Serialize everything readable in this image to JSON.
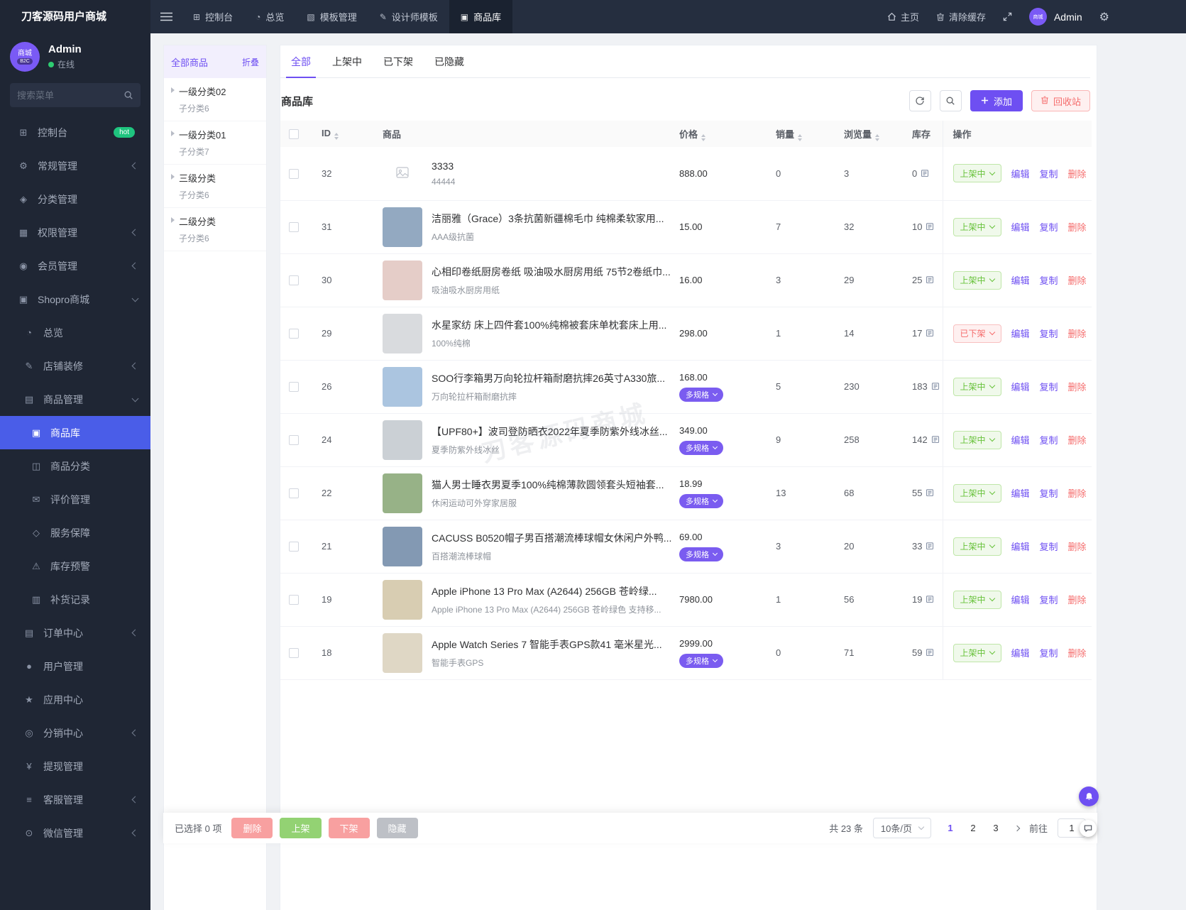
{
  "app": {
    "brand": "刀客源码用户商城",
    "watermark": "刀客源码商城"
  },
  "colors": {
    "accent_purple": "#6e4ff2",
    "sidebar_active_blue": "#4a5de8",
    "success_green": "#67c23a",
    "danger_red": "#f56c6c",
    "hot_badge_green": "#1fc47f",
    "sidebar_bg": "#1f2634",
    "navbar_bg": "#252e3f"
  },
  "navbar": {
    "tabs": [
      {
        "label": "控制台",
        "glyph": "⊞",
        "icon_name": "console-icon"
      },
      {
        "label": "总览",
        "glyph": "◔",
        "icon_name": "overview-icon"
      },
      {
        "label": "模板管理",
        "glyph": "▧",
        "icon_name": "template-icon"
      },
      {
        "label": "设计师模板",
        "glyph": "✎",
        "icon_name": "designer-template-icon"
      },
      {
        "label": "商品库",
        "glyph": "▣",
        "icon_name": "product-library-icon",
        "active": true
      }
    ],
    "home_label": "主页",
    "clear_cache_label": "清除缓存",
    "avatar_text": "商城",
    "user_name": "Admin"
  },
  "sidebar": {
    "profile": {
      "avatar_text": "商城",
      "avatar_badge": "B2C",
      "name": "Admin",
      "status": "在线"
    },
    "search_placeholder": "搜索菜单",
    "items": [
      {
        "label": "控制台",
        "glyph": "⊞",
        "icon_name": "console-icon",
        "cls": "lvl1",
        "badge": "hot"
      },
      {
        "label": "常规管理",
        "glyph": "⚙",
        "icon_name": "settings-icon",
        "cls": "lvl1",
        "chevron": true
      },
      {
        "label": "分类管理",
        "glyph": "◈",
        "icon_name": "category-icon",
        "cls": "lvl1"
      },
      {
        "label": "权限管理",
        "glyph": "▦",
        "icon_name": "permissions-icon",
        "cls": "lvl1",
        "chevron": true
      },
      {
        "label": "会员管理",
        "glyph": "◉",
        "icon_name": "members-icon",
        "cls": "lvl1",
        "chevron": true
      },
      {
        "label": "Shopro商城",
        "glyph": "▣",
        "icon_name": "shop-cart-icon",
        "cls": "lvl1",
        "chevron": true,
        "expanded": true
      },
      {
        "label": "总览",
        "glyph": "◔",
        "icon_name": "overview-icon",
        "cls": "lvl2"
      },
      {
        "label": "店铺装修",
        "glyph": "✎",
        "icon_name": "shop-decor-icon",
        "cls": "lvl2",
        "chevron": true
      },
      {
        "label": "商品管理",
        "glyph": "▤",
        "icon_name": "goods-icon",
        "cls": "lvl2",
        "chevron": true,
        "expanded": true
      },
      {
        "label": "商品库",
        "glyph": "▣",
        "icon_name": "product-library-icon",
        "cls": "lvl3",
        "active": true
      },
      {
        "label": "商品分类",
        "glyph": "◫",
        "icon_name": "product-category-icon",
        "cls": "lvl3"
      },
      {
        "label": "评价管理",
        "glyph": "✉",
        "icon_name": "review-icon",
        "cls": "lvl3"
      },
      {
        "label": "服务保障",
        "glyph": "◇",
        "icon_name": "service-guarantee-icon",
        "cls": "lvl3"
      },
      {
        "label": "库存预警",
        "glyph": "⚠",
        "icon_name": "stock-warning-icon",
        "cls": "lvl3"
      },
      {
        "label": "补货记录",
        "glyph": "▥",
        "icon_name": "restock-record-icon",
        "cls": "lvl3"
      },
      {
        "label": "订单中心",
        "glyph": "▤",
        "icon_name": "order-center-icon",
        "cls": "lvl2",
        "chevron": true
      },
      {
        "label": "用户管理",
        "glyph": "●",
        "icon_name": "user-management-icon",
        "cls": "lvl2"
      },
      {
        "label": "应用中心",
        "glyph": "★",
        "icon_name": "app-center-icon",
        "cls": "lvl2"
      },
      {
        "label": "分销中心",
        "glyph": "◎",
        "icon_name": "distribution-icon",
        "cls": "lvl2",
        "chevron": true
      },
      {
        "label": "提现管理",
        "glyph": "¥",
        "icon_name": "withdraw-icon",
        "cls": "lvl2"
      },
      {
        "label": "客服管理",
        "glyph": "≡",
        "icon_name": "support-icon",
        "cls": "lvl2",
        "chevron": true
      },
      {
        "label": "微信管理",
        "glyph": "⊙",
        "icon_name": "wechat-icon",
        "cls": "lvl2",
        "chevron": true
      }
    ]
  },
  "category_panel": {
    "title": "全部商品",
    "collapse_label": "折叠",
    "items": [
      {
        "label": "一级分类02",
        "sub": "子分类6"
      },
      {
        "label": "一级分类01",
        "sub": "子分类7"
      },
      {
        "label": "三级分类",
        "sub": "子分类6"
      },
      {
        "label": "二级分类",
        "sub": "子分类6"
      }
    ]
  },
  "main": {
    "tabs": [
      {
        "label": "全部",
        "active": true
      },
      {
        "label": "上架中"
      },
      {
        "label": "已下架"
      },
      {
        "label": "已隐藏"
      }
    ],
    "panel_title": "商品库",
    "add_label": "添加",
    "recycle_label": "回收站",
    "multi_spec_label": "多规格",
    "actions": {
      "edit": "编辑",
      "copy": "复制",
      "delete": "删除"
    },
    "table": {
      "columns": {
        "id": "ID",
        "product": "商品",
        "price": "价格",
        "sales": "销量",
        "views": "浏览量",
        "stock": "库存",
        "actions": "操作"
      },
      "rows": [
        {
          "id": "32",
          "title": "3333",
          "subtitle": "44444",
          "price": "888.00",
          "multi": false,
          "sales": "0",
          "views": "3",
          "stock": "0",
          "status": "上架中",
          "off": false,
          "img": null,
          "no_img": true
        },
        {
          "id": "31",
          "title": "洁丽雅（Grace）3条抗菌新疆棉毛巾 纯棉柔软家用...",
          "subtitle": "AAA级抗菌",
          "price": "15.00",
          "multi": false,
          "sales": "7",
          "views": "32",
          "stock": "10",
          "status": "上架中",
          "off": false,
          "img": "#93a9c1"
        },
        {
          "id": "30",
          "title": "心相印卷纸厨房卷纸 吸油吸水厨房用纸 75节2卷纸巾...",
          "subtitle": "吸油吸水厨房用纸",
          "price": "16.00",
          "multi": false,
          "sales": "3",
          "views": "29",
          "stock": "25",
          "status": "上架中",
          "off": false,
          "img": "#e5cdc8"
        },
        {
          "id": "29",
          "title": "水星家纺 床上四件套100%纯棉被套床单枕套床上用...",
          "subtitle": "100%纯棉",
          "price": "298.00",
          "multi": false,
          "sales": "1",
          "views": "14",
          "stock": "17",
          "status": "已下架",
          "off": true,
          "img": "#d9dbde"
        },
        {
          "id": "26",
          "title": "SOO行李箱男万向轮拉杆箱耐磨抗摔26英寸A330旅...",
          "subtitle": "万向轮拉杆箱耐磨抗摔",
          "price": "168.00",
          "multi": true,
          "sales": "5",
          "views": "230",
          "stock": "183",
          "status": "上架中",
          "off": false,
          "img": "#abc5e0"
        },
        {
          "id": "24",
          "title": "【UPF80+】波司登防晒衣2022年夏季防紫外线冰丝...",
          "subtitle": "夏季防紫外线冰丝",
          "price": "349.00",
          "multi": true,
          "sales": "9",
          "views": "258",
          "stock": "142",
          "status": "上架中",
          "off": false,
          "img": "#cbd0d5"
        },
        {
          "id": "22",
          "title": "猫人男士睡衣男夏季100%纯棉薄款圆领套头短袖套...",
          "subtitle": "休闲运动可外穿家居服",
          "price": "18.99",
          "multi": true,
          "sales": "13",
          "views": "68",
          "stock": "55",
          "status": "上架中",
          "off": false,
          "img": "#97b287"
        },
        {
          "id": "21",
          "title": "CACUSS B0520帽子男百搭潮流棒球帽女休闲户外鸭...",
          "subtitle": "百搭潮流棒球帽",
          "price": "69.00",
          "multi": true,
          "sales": "3",
          "views": "20",
          "stock": "33",
          "status": "上架中",
          "off": false,
          "img": "#8399b3"
        },
        {
          "id": "19",
          "title": "Apple iPhone 13 Pro Max (A2644) 256GB 苍岭绿...",
          "subtitle": "Apple iPhone 13 Pro Max (A2644) 256GB 苍岭绿色 支持移...",
          "price": "7980.00",
          "multi": false,
          "sales": "1",
          "views": "56",
          "stock": "19",
          "status": "上架中",
          "off": false,
          "img": "#d8cdb2"
        },
        {
          "id": "18",
          "title": "Apple Watch Series 7 智能手表GPS款41 毫米星光...",
          "subtitle": "智能手表GPS",
          "price": "2999.00",
          "multi": true,
          "sales": "0",
          "views": "71",
          "stock": "59",
          "status": "上架中",
          "off": false,
          "img": "#dfd7c5"
        }
      ]
    }
  },
  "footer": {
    "selected_label": "已选择 0 项",
    "batch_buttons": [
      {
        "label": "删除",
        "cls": "b-red"
      },
      {
        "label": "上架",
        "cls": "b-green"
      },
      {
        "label": "下架",
        "cls": "b-red"
      },
      {
        "label": "隐藏",
        "cls": "b-gray"
      }
    ],
    "total_label": "共 23 条",
    "page_size": "10条/页",
    "pages": [
      {
        "label": "1",
        "active": true
      },
      {
        "label": "2"
      },
      {
        "label": "3"
      }
    ],
    "goto_label": "前往",
    "goto_value": "1"
  }
}
